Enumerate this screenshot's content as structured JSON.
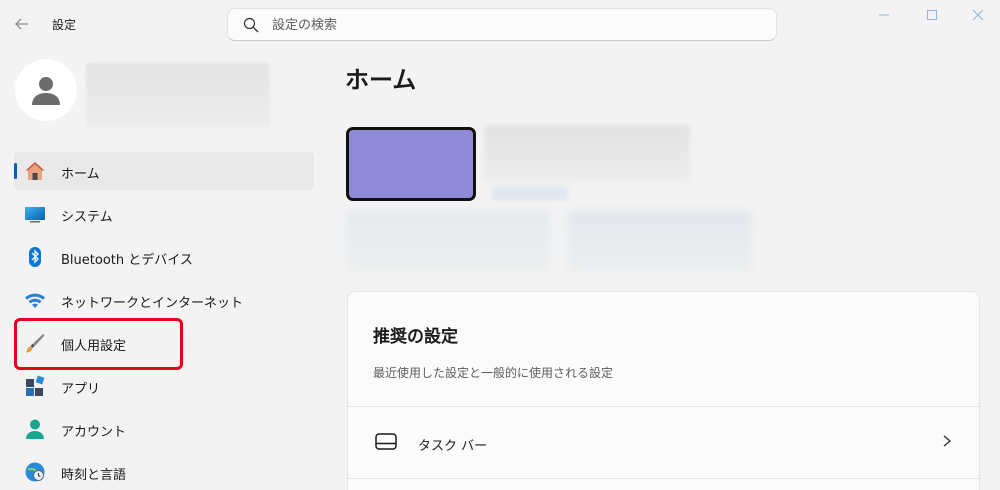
{
  "window": {
    "title": "設定"
  },
  "search": {
    "placeholder": "設定の検索",
    "value": ""
  },
  "page": {
    "title": "ホーム"
  },
  "sidebar": {
    "items": [
      {
        "label": "ホーム",
        "icon": "home-icon",
        "active": true
      },
      {
        "label": "システム",
        "icon": "system-icon"
      },
      {
        "label": "Bluetooth とデバイス",
        "icon": "bluetooth-icon"
      },
      {
        "label": "ネットワークとインターネット",
        "icon": "wifi-icon"
      },
      {
        "label": "個人用設定",
        "icon": "brush-icon",
        "highlighted": true
      },
      {
        "label": "アプリ",
        "icon": "apps-icon"
      },
      {
        "label": "アカウント",
        "icon": "account-icon"
      },
      {
        "label": "時刻と言語",
        "icon": "time-language-icon"
      }
    ]
  },
  "recommended": {
    "title": "推奨の設定",
    "description": "最近使用した設定と一般的に使用される設定",
    "items": [
      {
        "label": "タスク バー",
        "icon": "taskbar-icon"
      }
    ]
  },
  "colors": {
    "accent": "#005fb8",
    "highlight": "#e8001c",
    "device": "#8f8ad6"
  }
}
